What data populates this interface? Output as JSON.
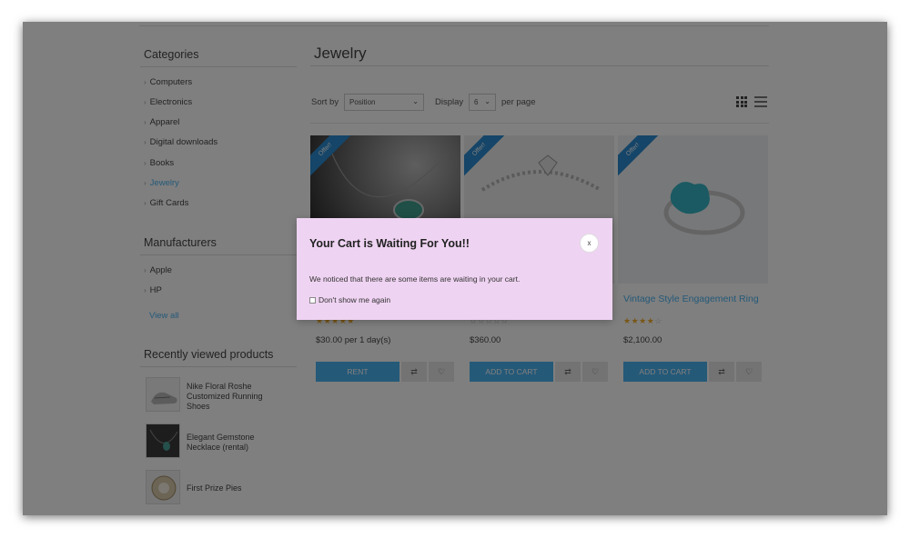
{
  "sidebar": {
    "categories_title": "Categories",
    "categories": [
      "Computers",
      "Electronics",
      "Apparel",
      "Digital downloads",
      "Books",
      "Jewelry",
      "Gift Cards"
    ],
    "active_category": "Jewelry",
    "manufacturers_title": "Manufacturers",
    "manufacturers": [
      "Apple",
      "HP"
    ],
    "view_all": "View all",
    "recent_title": "Recently viewed products",
    "recent": [
      "Nike Floral Roshe Customized Running Shoes",
      "Elegant Gemstone Necklace (rental)",
      "First Prize Pies"
    ]
  },
  "main": {
    "title": "Jewelry",
    "sort_label": "Sort by",
    "sort_value": "Position",
    "display_label": "Display",
    "display_value": "6",
    "per_page_label": "per page"
  },
  "products": [
    {
      "ribbon": "Offer!",
      "name": "",
      "rating": 5,
      "price": "$30.00 per 1 day(s)",
      "button": "RENT"
    },
    {
      "ribbon": "Offer!",
      "name": "",
      "rating": 0,
      "price": "$360.00",
      "button": "ADD TO CART"
    },
    {
      "ribbon": "Offer!",
      "name": "Vintage Style Engagement Ring",
      "rating": 4,
      "price": "$2,100.00",
      "button": "ADD TO CART"
    }
  ],
  "modal": {
    "title": "Your Cart is Waiting For You!!",
    "close": "x",
    "message": "We noticed that there are some items are waiting in your cart.",
    "checkbox_label": "Don't show me again",
    "background": "#efd3f2"
  },
  "colors": {
    "accent": "#4ab2f1",
    "ribbon": "#2b8bd0"
  }
}
